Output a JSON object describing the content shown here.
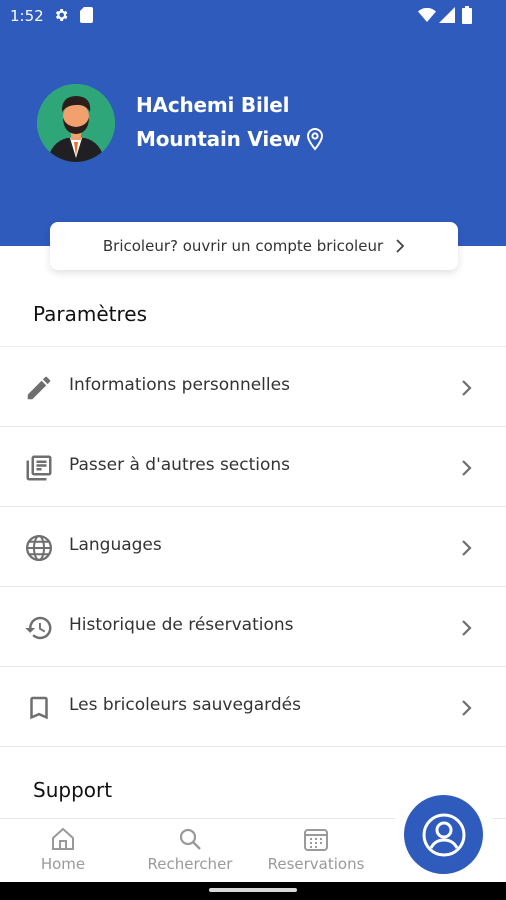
{
  "status_bar": {
    "time": "1:52"
  },
  "profile": {
    "name": "HAchemi Bilel",
    "location": "Mountain View"
  },
  "pro_card": {
    "label": "Bricoleur? ouvrir un compte bricoleur"
  },
  "settings": {
    "title": "Paramètres",
    "items": [
      {
        "label": "Informations personnelles",
        "icon": "pencil-icon"
      },
      {
        "label": "Passer à d'autres sections",
        "icon": "library-books-icon"
      },
      {
        "label": "Languages",
        "icon": "globe-icon"
      },
      {
        "label": "Historique de réservations",
        "icon": "history-icon"
      },
      {
        "label": "Les bricoleurs sauvegardés",
        "icon": "bookmark-icon"
      }
    ]
  },
  "support": {
    "title": "Support"
  },
  "bottom_nav": {
    "home": "Home",
    "search": "Rechercher",
    "reservations": "Reservations"
  },
  "colors": {
    "primary": "#2f5bbd",
    "avatar_bg": "#2fa67a",
    "nav_inactive": "#9a9a9a"
  }
}
